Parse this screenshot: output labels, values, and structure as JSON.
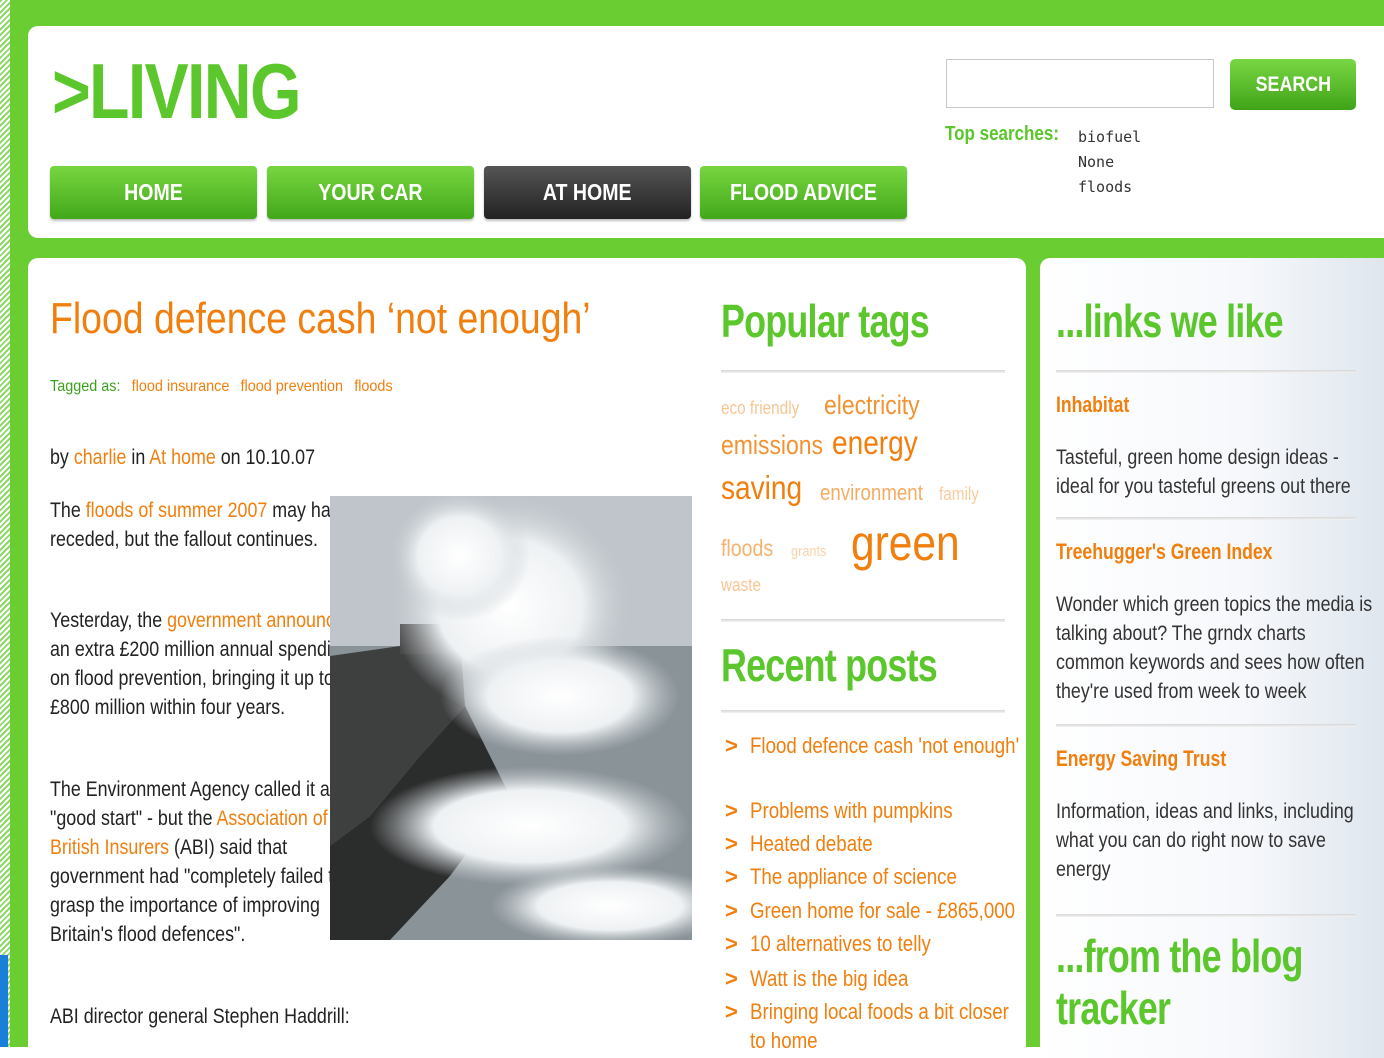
{
  "header": {
    "logo": ">LIVING",
    "nav": [
      {
        "label": "HOME",
        "active": false
      },
      {
        "label": "YOUR CAR",
        "active": false
      },
      {
        "label": "AT HOME",
        "active": true
      },
      {
        "label": "FLOOD ADVICE",
        "active": false
      }
    ],
    "search": {
      "value": "",
      "button": "SEARCH"
    },
    "top_searches": {
      "label": "Top searches:",
      "items": [
        "biofuel",
        "None",
        "floods"
      ]
    }
  },
  "article": {
    "title": "Flood defence cash ‘not enough’",
    "tagged_label": "Tagged as:",
    "tags": [
      "flood insurance",
      "flood prevention",
      "floods"
    ],
    "byline": {
      "by": "by",
      "author": "charlie",
      "in": "in",
      "section": "At home",
      "on": "on 10.10.07"
    },
    "p1": {
      "t1": "The ",
      "link": "floods of summer 2007",
      "t2": " may have receded, but the fallout continues."
    },
    "p2": {
      "t1": "Yesterday, the ",
      "link": "government announced",
      "t2": " an extra £200 million annual spending on flood prevention, bringing it up to £800 million within four years."
    },
    "p3": {
      "t1": "The Environment Agency called it a \"good start\" - but the ",
      "link": "Association of British Insurers",
      "t2": " (ABI) said that government had \"completely failed to grasp the importance of improving Britain's flood defences\"."
    },
    "p4": "ABI director general Stephen Haddrill:"
  },
  "popular_tags": {
    "heading": "Popular tags",
    "tags": [
      "eco friendly",
      "electricity",
      "emissions",
      "energy",
      "saving",
      "environment",
      "family",
      "floods",
      "grants",
      "green",
      "waste"
    ]
  },
  "recent_posts": {
    "heading": "Recent posts",
    "items": [
      "Flood defence cash 'not enough'",
      "Problems with pumpkins",
      "Heated debate",
      "The appliance of science",
      "Green home for sale - £865,000",
      "10 alternatives to telly",
      "Watt is the big idea",
      "Bringing local foods a bit closer to home"
    ]
  },
  "links_we_like": {
    "heading": "...links we like",
    "links": [
      {
        "title": "Inhabitat",
        "desc": "Tasteful, green home design ideas - ideal for you tasteful greens out there"
      },
      {
        "title": "Treehugger's Green Index",
        "desc": "Wonder which green topics the media is talking about? The grndx charts common keywords and sees how often they're used from week to week"
      },
      {
        "title": "Energy Saving Trust",
        "desc": "Information, ideas and links, including what you can do right now to save energy"
      }
    ]
  },
  "blog_tracker": {
    "heading": "...from the blog tracker"
  },
  "colors": {
    "brand_green": "#5bc72c",
    "accent_orange": "#f07f0e",
    "active_nav": "#333333"
  }
}
